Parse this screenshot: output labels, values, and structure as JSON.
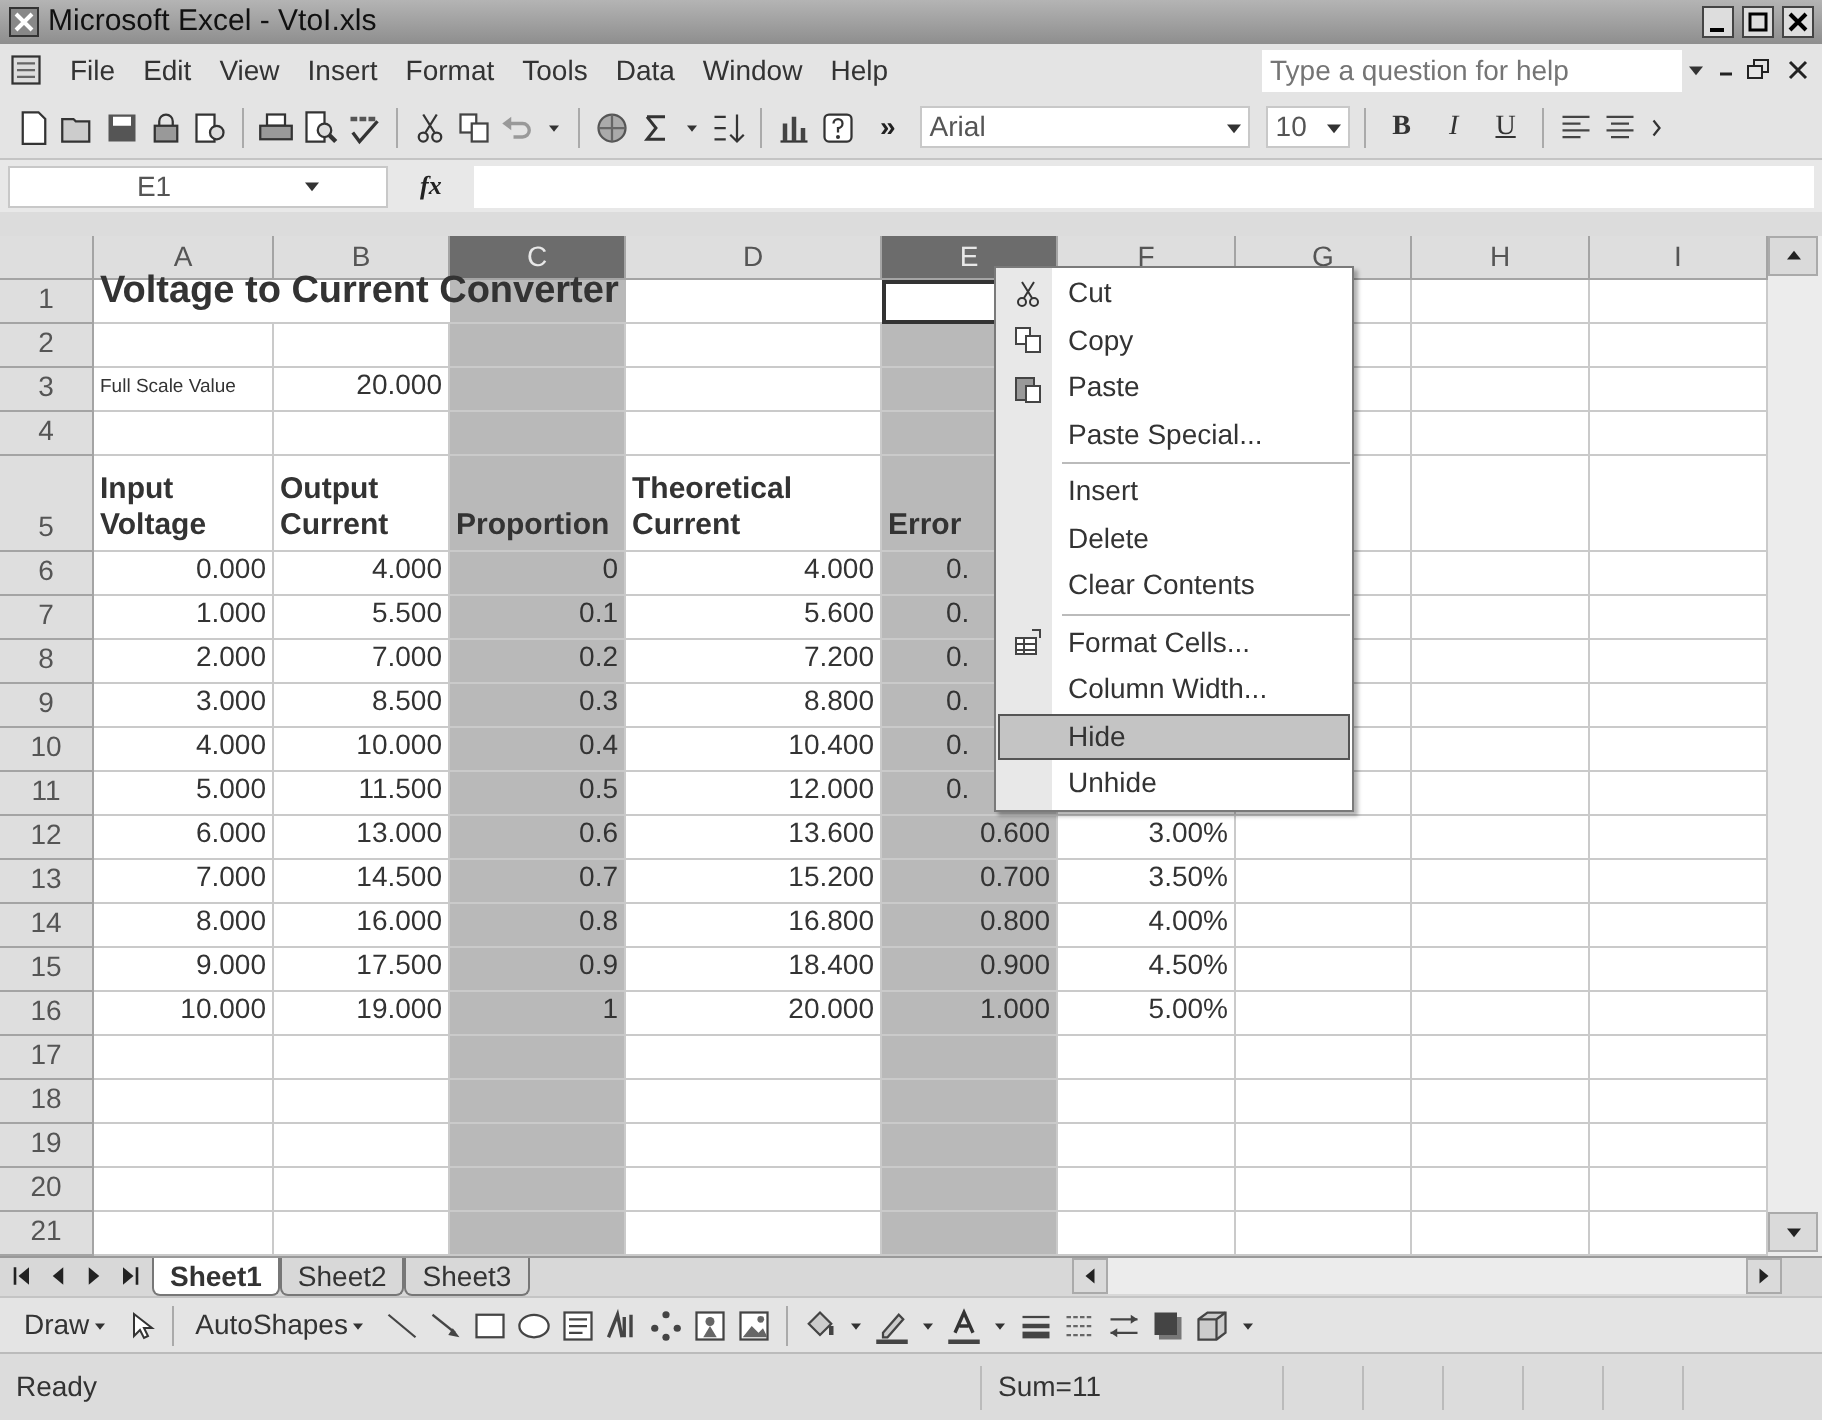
{
  "window": {
    "title": "Microsoft Excel - VtoI.xls"
  },
  "menu_bar": [
    {
      "label": "File"
    },
    {
      "label": "Edit"
    },
    {
      "label": "View"
    },
    {
      "label": "Insert"
    },
    {
      "label": "Format"
    },
    {
      "label": "Tools"
    },
    {
      "label": "Data"
    },
    {
      "label": "Window"
    },
    {
      "label": "Help"
    }
  ],
  "help_box": {
    "placeholder": "Type a question for help"
  },
  "toolbar": {
    "overflow": "»",
    "font": "Arial",
    "size": "10",
    "format_buttons": [
      "B",
      "I",
      "U"
    ]
  },
  "formula_bar": {
    "name_box": "E1",
    "function_label": "fx"
  },
  "columns": [
    {
      "label": "A",
      "selected": false
    },
    {
      "label": "B",
      "selected": false
    },
    {
      "label": "C",
      "selected": true
    },
    {
      "label": "D",
      "selected": false
    },
    {
      "label": "E",
      "selected": true
    },
    {
      "label": "F",
      "selected": false
    },
    {
      "label": "G",
      "selected": false
    },
    {
      "label": "H",
      "selected": false
    },
    {
      "label": "I",
      "selected": false
    }
  ],
  "rows": [
    {
      "label": "1",
      "cells": [
        {
          "text": "Voltage to Current Converter",
          "kind": "title"
        },
        null,
        null,
        null,
        {
          "active": true
        }
      ]
    },
    {
      "label": "2"
    },
    {
      "label": "3",
      "cells": [
        {
          "text": "Full Scale Value",
          "kind": "note"
        },
        {
          "text": "20.000",
          "kind": "number"
        }
      ]
    },
    {
      "label": "4"
    },
    {
      "label": "5",
      "cells": [
        {
          "text": "Input Voltage",
          "kind": "heading"
        },
        {
          "text": "Output Current",
          "kind": "heading"
        },
        {
          "text": "Proportion",
          "kind": "heading"
        },
        {
          "text": "Theoretical Current",
          "kind": "heading"
        },
        {
          "text": "Error",
          "kind": "heading"
        }
      ]
    },
    {
      "label": "6",
      "cells": [
        {
          "text": "0.000",
          "kind": "number"
        },
        {
          "text": "4.000",
          "kind": "number"
        },
        {
          "text": "0",
          "kind": "number"
        },
        {
          "text": "4.000",
          "kind": "number"
        },
        {
          "text": "0.",
          "kind": "number",
          "covered": true
        }
      ]
    },
    {
      "label": "7",
      "cells": [
        {
          "text": "1.000",
          "kind": "number"
        },
        {
          "text": "5.500",
          "kind": "number"
        },
        {
          "text": "0.1",
          "kind": "number"
        },
        {
          "text": "5.600",
          "kind": "number"
        },
        {
          "text": "0.",
          "kind": "number",
          "covered": true
        }
      ]
    },
    {
      "label": "8",
      "cells": [
        {
          "text": "2.000",
          "kind": "number"
        },
        {
          "text": "7.000",
          "kind": "number"
        },
        {
          "text": "0.2",
          "kind": "number"
        },
        {
          "text": "7.200",
          "kind": "number"
        },
        {
          "text": "0.",
          "kind": "number",
          "covered": true
        }
      ]
    },
    {
      "label": "9",
      "cells": [
        {
          "text": "3.000",
          "kind": "number"
        },
        {
          "text": "8.500",
          "kind": "number"
        },
        {
          "text": "0.3",
          "kind": "number"
        },
        {
          "text": "8.800",
          "kind": "number"
        },
        {
          "text": "0.",
          "kind": "number",
          "covered": true
        }
      ]
    },
    {
      "label": "10",
      "cells": [
        {
          "text": "4.000",
          "kind": "number"
        },
        {
          "text": "10.000",
          "kind": "number"
        },
        {
          "text": "0.4",
          "kind": "number"
        },
        {
          "text": "10.400",
          "kind": "number"
        },
        {
          "text": "0.",
          "kind": "number",
          "covered": true
        }
      ]
    },
    {
      "label": "11",
      "cells": [
        {
          "text": "5.000",
          "kind": "number"
        },
        {
          "text": "11.500",
          "kind": "number"
        },
        {
          "text": "0.5",
          "kind": "number"
        },
        {
          "text": "12.000",
          "kind": "number"
        },
        {
          "text": "0.",
          "kind": "number",
          "covered": true
        }
      ]
    },
    {
      "label": "12",
      "cells": [
        {
          "text": "6.000",
          "kind": "number"
        },
        {
          "text": "13.000",
          "kind": "number"
        },
        {
          "text": "0.6",
          "kind": "number"
        },
        {
          "text": "13.600",
          "kind": "number"
        },
        {
          "text": "0.600",
          "kind": "number"
        },
        {
          "text": "3.00%",
          "kind": "number"
        }
      ]
    },
    {
      "label": "13",
      "cells": [
        {
          "text": "7.000",
          "kind": "number"
        },
        {
          "text": "14.500",
          "kind": "number"
        },
        {
          "text": "0.7",
          "kind": "number"
        },
        {
          "text": "15.200",
          "kind": "number"
        },
        {
          "text": "0.700",
          "kind": "number"
        },
        {
          "text": "3.50%",
          "kind": "number"
        }
      ]
    },
    {
      "label": "14",
      "cells": [
        {
          "text": "8.000",
          "kind": "number"
        },
        {
          "text": "16.000",
          "kind": "number"
        },
        {
          "text": "0.8",
          "kind": "number"
        },
        {
          "text": "16.800",
          "kind": "number"
        },
        {
          "text": "0.800",
          "kind": "number"
        },
        {
          "text": "4.00%",
          "kind": "number"
        }
      ]
    },
    {
      "label": "15",
      "cells": [
        {
          "text": "9.000",
          "kind": "number"
        },
        {
          "text": "17.500",
          "kind": "number"
        },
        {
          "text": "0.9",
          "kind": "number"
        },
        {
          "text": "18.400",
          "kind": "number"
        },
        {
          "text": "0.900",
          "kind": "number"
        },
        {
          "text": "4.50%",
          "kind": "number"
        }
      ]
    },
    {
      "label": "16",
      "cells": [
        {
          "text": "10.000",
          "kind": "number"
        },
        {
          "text": "19.000",
          "kind": "number"
        },
        {
          "text": "1",
          "kind": "number"
        },
        {
          "text": "20.000",
          "kind": "number"
        },
        {
          "text": "1.000",
          "kind": "number"
        },
        {
          "text": "5.00%",
          "kind": "number"
        }
      ]
    },
    {
      "label": "17"
    },
    {
      "label": "18"
    },
    {
      "label": "19"
    },
    {
      "label": "20"
    },
    {
      "label": "21"
    }
  ],
  "context_menu": [
    {
      "kind": "item",
      "label": "Cut",
      "selected": false
    },
    {
      "kind": "item",
      "label": "Copy",
      "selected": false
    },
    {
      "kind": "item",
      "label": "Paste",
      "selected": false
    },
    {
      "kind": "item",
      "label": "Paste Special...",
      "selected": false
    },
    {
      "kind": "separator"
    },
    {
      "kind": "item",
      "label": "Insert",
      "selected": false
    },
    {
      "kind": "item",
      "label": "Delete",
      "selected": false
    },
    {
      "kind": "item",
      "label": "Clear Contents",
      "selected": false
    },
    {
      "kind": "separator"
    },
    {
      "kind": "item",
      "label": "Format Cells...",
      "selected": false
    },
    {
      "kind": "item",
      "label": "Column Width...",
      "selected": false
    },
    {
      "kind": "item",
      "label": "Hide",
      "selected": true
    },
    {
      "kind": "item",
      "label": "Unhide",
      "selected": false
    }
  ],
  "sheet_tabs": [
    {
      "label": "Sheet1",
      "selected": true
    },
    {
      "label": "Sheet2",
      "selected": false
    },
    {
      "label": "Sheet3",
      "selected": false
    }
  ],
  "drawing_toolbar": [
    {
      "label": "Draw"
    },
    {
      "label": "AutoShapes"
    }
  ],
  "status_bar": {
    "text": "Ready",
    "sum": "Sum=11"
  }
}
